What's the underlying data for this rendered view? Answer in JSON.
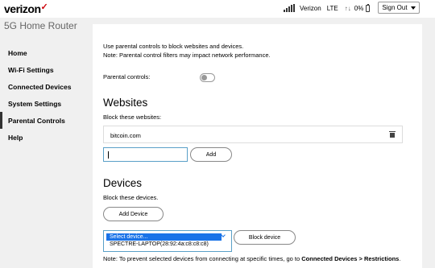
{
  "header": {
    "brand": "verizon",
    "brand_mark": "✓",
    "carrier": "Verizon",
    "network": "LTE",
    "data_arrows": "↑↓",
    "battery": "0%",
    "signout_label": "Sign Out",
    "product_title": "5G Home Router"
  },
  "sidebar": {
    "items": [
      {
        "label": "Home"
      },
      {
        "label": "Wi-Fi Settings"
      },
      {
        "label": "Connected Devices"
      },
      {
        "label": "System Settings"
      },
      {
        "label": "Parental Controls"
      },
      {
        "label": "Help"
      }
    ],
    "active": "Parental Controls"
  },
  "main": {
    "intro_line1": "Use parental controls to block websites and devices.",
    "intro_line2": "Note: Parental control filters may impact network performance.",
    "toggle_label": "Parental controls:",
    "toggle_on": false,
    "websites": {
      "heading": "Websites",
      "subtext": "Block these websites:",
      "blocked": [
        "bitcoin.com"
      ],
      "input_value": "",
      "add_label": "Add"
    },
    "devices": {
      "heading": "Devices",
      "subtext": "Block these devices.",
      "add_device_label": "Add Device",
      "select_placeholder": "Select device...",
      "select_option": "SPECTRE-LAPTOP(28:92:4a:c8:c8:c8)",
      "block_label": "Block device"
    },
    "note_prefix": "Note: To prevent selected devices from connecting at specific times, go to ",
    "note_link": "Connected Devices > Restrictions",
    "note_suffix": "."
  },
  "colors": {
    "brand_red": "#cd040b",
    "focus_blue": "#5aa0c8",
    "selection_blue": "#1a73e8"
  }
}
